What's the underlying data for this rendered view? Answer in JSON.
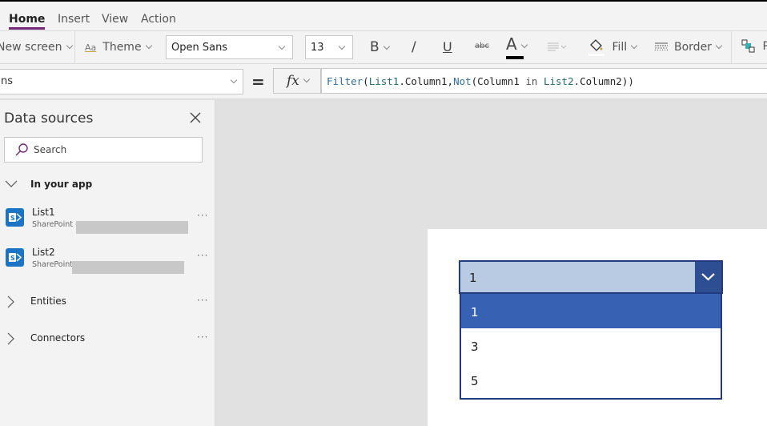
{
  "ribbon": {
    "tabs": [
      {
        "label": "Home",
        "active": true
      },
      {
        "label": "Insert",
        "active": false
      },
      {
        "label": "View",
        "active": false
      },
      {
        "label": "Action",
        "active": false
      }
    ],
    "accent_color": "#742774"
  },
  "toolbar": {
    "new_screen_label": "New screen",
    "theme_label": "Theme",
    "font_family_value": "Open Sans",
    "font_size_value": "13",
    "bold_label": "B",
    "italic_label": "/",
    "underline_label": "U",
    "strikethrough_label": "abc",
    "font_color_label": "A",
    "fill_label": "Fill",
    "border_label": "Border",
    "reorder_label": "R"
  },
  "formula_bar": {
    "property_value": "ns",
    "equals": "=",
    "fx_label": "fx",
    "formula_parts": [
      {
        "text": "Filter",
        "kind": "fn"
      },
      {
        "text": "(",
        "kind": "plain"
      },
      {
        "text": "List1",
        "kind": "ref"
      },
      {
        "text": ".Column1,",
        "kind": "plain"
      },
      {
        "text": "Not",
        "kind": "fn"
      },
      {
        "text": "(Column1 ",
        "kind": "plain"
      },
      {
        "text": "in",
        "kind": "kw"
      },
      {
        "text": " ",
        "kind": "plain"
      },
      {
        "text": "List2",
        "kind": "ref"
      },
      {
        "text": ".Column2))",
        "kind": "plain"
      }
    ],
    "formula": "Filter(List1.Column1,Not(Column1 in List2.Column2))"
  },
  "data_sources_panel": {
    "title": "Data sources",
    "search_placeholder": "Search",
    "in_your_app_label": "In your app",
    "sources": [
      {
        "name": "List1",
        "type": "SharePoint -"
      },
      {
        "name": "List2",
        "type": "SharePoint"
      }
    ],
    "entities_label": "Entities",
    "connectors_label": "Connectors",
    "more_label": "···"
  },
  "canvas": {
    "dropdown": {
      "selected_value": "1",
      "options": [
        {
          "label": "1",
          "highlighted": true
        },
        {
          "label": "3",
          "highlighted": false
        },
        {
          "label": "5",
          "highlighted": false
        }
      ],
      "colors": {
        "field_bg": "#b9cae3",
        "button_bg": "#2d4e92",
        "border": "#233a80",
        "highlight": "#3762b4"
      }
    }
  }
}
